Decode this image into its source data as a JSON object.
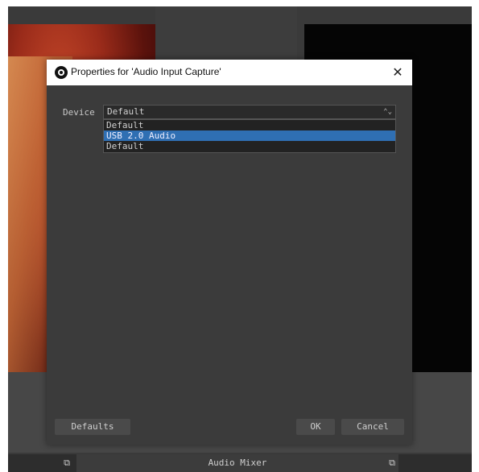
{
  "dialog": {
    "title": "Properties for 'Audio Input Capture'",
    "close_glyph": "✕",
    "device_label": "Device",
    "device_value": "Default",
    "dropdown_arrow": "⌃⌄",
    "options": [
      {
        "label": "Default",
        "selected": false
      },
      {
        "label": "USB 2.0 Audio",
        "selected": true
      },
      {
        "label": "Default",
        "selected": false
      }
    ],
    "defaults_button": "Defaults",
    "ok_button": "OK",
    "cancel_button": "Cancel"
  },
  "background": {
    "mixer_label": "Audio Mixer",
    "dock_icon_glyph": "⧉"
  },
  "colors": {
    "dialog_bg": "#3b3b3b",
    "selection": "#2f6fb3",
    "titlebar": "#ffffff"
  },
  "icons": [
    "obs-logo-icon",
    "close-icon",
    "dock-float-icon"
  ]
}
